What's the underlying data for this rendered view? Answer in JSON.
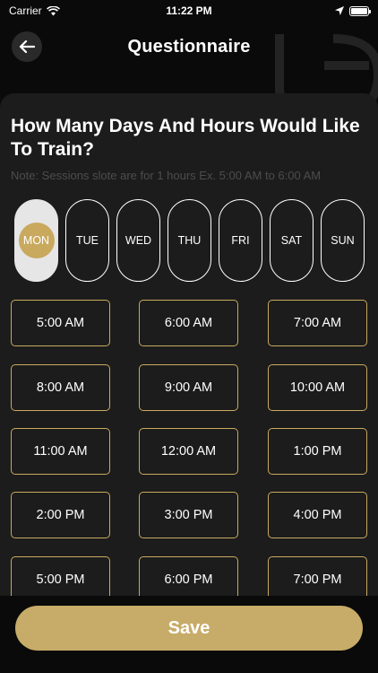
{
  "status_bar": {
    "carrier": "Carrier",
    "time": "11:22 PM"
  },
  "header": {
    "title": "Questionnaire",
    "back_icon": "arrow-left-icon"
  },
  "question": {
    "text": "How Many Days And Hours Would Like To Train?",
    "note": "Note: Sessions slote are for 1 hours Ex. 5:00 AM to 6:00 AM"
  },
  "days": [
    {
      "label": "MON",
      "selected": true
    },
    {
      "label": "TUE",
      "selected": false
    },
    {
      "label": "WED",
      "selected": false
    },
    {
      "label": "THU",
      "selected": false
    },
    {
      "label": "FRI",
      "selected": false
    },
    {
      "label": "SAT",
      "selected": false
    },
    {
      "label": "SUN",
      "selected": false
    }
  ],
  "time_slots": [
    "5:00 AM",
    "6:00 AM",
    "7:00 AM",
    "8:00 AM",
    "9:00 AM",
    "10:00 AM",
    "11:00 AM",
    "12:00 AM",
    "1:00 PM",
    "2:00 PM",
    "3:00 PM",
    "4:00 PM",
    "5:00 PM",
    "6:00 PM",
    "7:00 PM"
  ],
  "save_label": "Save",
  "colors": {
    "accent": "#c9a95e",
    "save": "#c7ab68",
    "background": "#0a0a0a",
    "card": "#1c1c1c",
    "note": "#4d4d4d"
  }
}
